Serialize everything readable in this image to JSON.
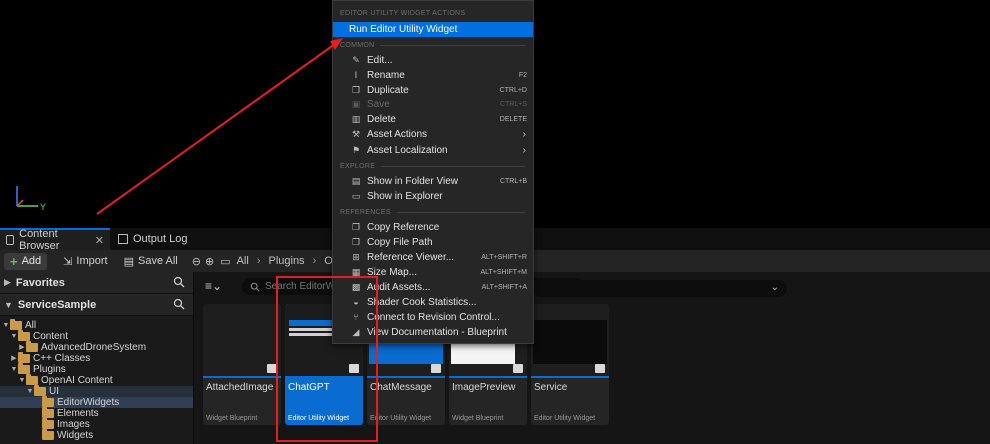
{
  "viewport": {
    "axis_label": "Y"
  },
  "tabs": [
    {
      "label": "Content Browser",
      "close": "✕"
    },
    {
      "label": "Output Log"
    }
  ],
  "toolbar": {
    "add_label": "Add",
    "import_label": "Import",
    "save_all_label": "Save All",
    "breadcrumbs": [
      "All",
      "Plugins",
      "Open"
    ]
  },
  "sidebar": {
    "favorites_label": "Favorites",
    "project_label": "ServiceSample",
    "tree": [
      {
        "label": "All",
        "indent": 0
      },
      {
        "label": "Content",
        "indent": 1
      },
      {
        "label": "AdvancedDroneSystem",
        "indent": 2
      },
      {
        "label": "C++ Classes",
        "indent": 1
      },
      {
        "label": "Plugins",
        "indent": 1
      },
      {
        "label": "OpenAI Content",
        "indent": 2
      },
      {
        "label": "UI",
        "indent": 3
      },
      {
        "label": "EditorWidgets",
        "indent": 4
      },
      {
        "label": "Elements",
        "indent": 4
      },
      {
        "label": "Images",
        "indent": 4
      },
      {
        "label": "Widgets",
        "indent": 4
      }
    ]
  },
  "search": {
    "placeholder": "Search EditorWidg"
  },
  "assets": [
    {
      "name": "AttachedImage",
      "type": "Widget Blueprint"
    },
    {
      "name": "ChatGPT",
      "type": "Editor Utility Widget"
    },
    {
      "name": "ChatMessage",
      "type": "Editor Utility Widget"
    },
    {
      "name": "ImagePreview",
      "type": "Widget Blueprint"
    },
    {
      "name": "Service",
      "type": "Editor Utility Widget"
    }
  ],
  "context_menu": {
    "sections": {
      "utility": "EDITOR UTILITY WIDGET ACTIONS",
      "common": "COMMON",
      "explore": "EXPLORE",
      "references": "REFERENCES"
    },
    "run_label": "Run Editor Utility Widget",
    "items": {
      "edit": {
        "label": "Edit..."
      },
      "rename": {
        "label": "Rename",
        "shortcut": "F2"
      },
      "duplicate": {
        "label": "Duplicate",
        "shortcut": "CTRL+D"
      },
      "save": {
        "label": "Save",
        "shortcut": "CTRL+S"
      },
      "delete": {
        "label": "Delete",
        "shortcut": "DELETE"
      },
      "asset_actions": {
        "label": "Asset Actions"
      },
      "asset_localization": {
        "label": "Asset Localization"
      },
      "show_folder": {
        "label": "Show in Folder View",
        "shortcut": "CTRL+B"
      },
      "show_explorer": {
        "label": "Show in Explorer"
      },
      "copy_reference": {
        "label": "Copy Reference"
      },
      "copy_file_path": {
        "label": "Copy File Path"
      },
      "reference_viewer": {
        "label": "Reference Viewer...",
        "shortcut": "ALT+SHIFT+R"
      },
      "size_map": {
        "label": "Size Map...",
        "shortcut": "ALT+SHIFT+M"
      },
      "audit_assets": {
        "label": "Audit Assets...",
        "shortcut": "ALT+SHIFT+A"
      },
      "shader_cook": {
        "label": "Shader Cook Statistics..."
      },
      "revision_control": {
        "label": "Connect to Revision Control..."
      },
      "view_docs": {
        "label": "View Documentation - Blueprint"
      }
    }
  },
  "colors": {
    "accent": "#0070e0",
    "annotation": "#e41f1f"
  }
}
